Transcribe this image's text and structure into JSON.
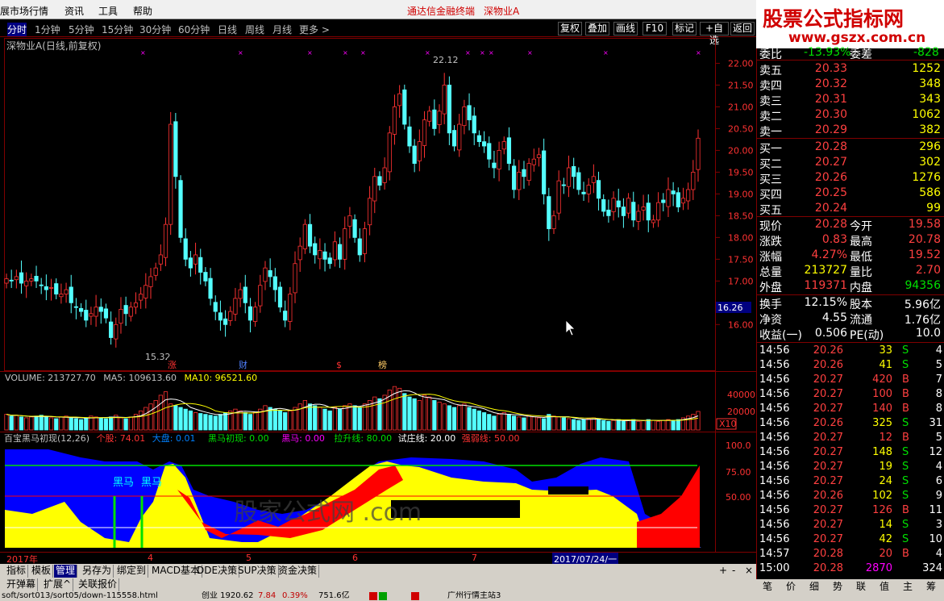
{
  "menu": {
    "items": [
      "展市场行情",
      "资讯",
      "工具",
      "帮助"
    ],
    "app_title": "通达信金融终端",
    "stock_title": "深物业A"
  },
  "logo": {
    "line1": "股票公式指标网",
    "line2": "www.gszx.com.cn"
  },
  "periods": {
    "items": [
      "分时",
      "1分钟",
      "5分钟",
      "15分钟",
      "30分钟",
      "60分钟",
      "日线",
      "周线",
      "月线",
      "更多 >"
    ],
    "active": "日线"
  },
  "toolbar_right": [
    "复权",
    "叠加",
    "画线",
    "F10",
    "标记",
    "+自选",
    "返回"
  ],
  "main_chart": {
    "caption": "深物业A(日线,前复权)",
    "high_label": "22.12",
    "low_label": "15.32",
    "current_price_tag": "16.26",
    "price_ticks": [
      "22.00",
      "21.50",
      "21.00",
      "20.50",
      "20.00",
      "19.50",
      "19.00",
      "18.50",
      "18.00",
      "17.50",
      "17.00",
      "16.00"
    ],
    "events": [
      "涨",
      "财",
      "$",
      "榜"
    ],
    "up_color": "#ff3232",
    "down_color": "#54ffff"
  },
  "chart_data": [
    {
      "type": "candlestick",
      "title": "深物业A(日线,前复权)",
      "ylim": [
        15.32,
        22.12
      ],
      "y_ticks": [
        16.0,
        17.0,
        17.5,
        18.0,
        18.5,
        19.0,
        19.5,
        20.0,
        20.5,
        21.0,
        21.5,
        22.0
      ],
      "close": [
        17.05,
        17.0,
        17.1,
        16.95,
        17.0,
        17.05,
        17.0,
        16.9,
        16.8,
        16.85,
        16.7,
        16.7,
        16.8,
        16.5,
        16.4,
        16.3,
        16.1,
        16.25,
        16.4,
        16.3,
        16.15,
        15.7,
        16.0,
        16.35,
        16.25,
        16.4,
        16.5,
        16.7,
        16.9,
        17.1,
        17.3,
        17.6,
        18.3,
        20.6,
        19.4,
        18.0,
        17.5,
        17.3,
        17.6,
        17.2,
        17.0,
        16.6,
        16.3,
        16.1,
        16.0,
        16.3,
        16.6,
        16.8,
        16.5,
        16.1,
        16.4,
        16.9,
        17.3,
        17.1,
        16.8,
        16.4,
        16.1,
        16.7,
        17.4,
        17.8,
        18.3,
        17.8,
        17.6,
        17.7,
        17.5,
        17.4,
        17.9,
        17.5,
        18.2,
        18.5,
        18.0,
        17.6,
        18.2,
        18.9,
        19.4,
        19.2,
        19.6,
        20.4,
        21.0,
        21.3,
        20.6,
        20.1,
        19.7,
        20.2,
        20.7,
        20.9,
        20.5,
        20.9,
        21.5,
        20.4,
        20.1,
        20.6,
        21.0,
        20.7,
        20.4,
        20.2,
        20.1,
        19.8,
        19.6,
        20.0,
        20.2,
        19.7,
        19.1,
        19.5,
        19.4,
        19.7,
        19.8,
        19.9,
        19.0,
        18.2,
        18.5,
        19.3,
        19.2,
        19.6,
        19.4,
        19.1,
        19.0,
        19.2,
        19.4,
        18.9,
        18.6,
        18.5,
        18.9,
        18.7,
        18.5,
        18.9,
        18.4,
        18.6,
        18.7,
        18.4,
        18.4,
        18.8,
        18.8,
        19.1,
        19.0,
        18.7,
        18.9,
        19.1,
        19.5,
        20.28
      ],
      "volume": [
        18000,
        16000,
        17000,
        15000,
        14000,
        15000,
        16000,
        17000,
        15000,
        14000,
        13000,
        15000,
        16000,
        14000,
        13000,
        12000,
        14000,
        16000,
        15000,
        14000,
        13000,
        15000,
        17000,
        14000,
        13000,
        15000,
        18000,
        22000,
        26000,
        30000,
        34000,
        40000,
        44000,
        30000,
        28000,
        26000,
        24000,
        22000,
        20000,
        19000,
        18000,
        17000,
        16000,
        18000,
        20000,
        22000,
        24000,
        22000,
        20000,
        18000,
        20000,
        24000,
        28000,
        26000,
        24000,
        22000,
        20000,
        22000,
        26000,
        30000,
        34000,
        30000,
        28000,
        26000,
        24000,
        22000,
        26000,
        24000,
        28000,
        30000,
        28000,
        26000,
        30000,
        34000,
        38000,
        36000,
        40000,
        46000,
        50000,
        48000,
        42000,
        38000,
        36000,
        34000,
        40000,
        38000,
        34000,
        32000,
        30000,
        28000,
        26000,
        28000,
        30000,
        26000,
        24000,
        22000,
        20000,
        18000,
        16000,
        18000,
        20000,
        18000,
        16000,
        15000,
        14000,
        16000,
        15000,
        14000,
        13000,
        18000,
        16000,
        15000,
        14000,
        13000,
        12000,
        11000,
        12000,
        13000,
        14000,
        12000,
        11000,
        10000,
        11000,
        12000,
        10000,
        11000,
        12000,
        10000,
        11000,
        12000,
        11000,
        10000,
        11000,
        12000,
        11000,
        12000,
        14000,
        16000,
        18000,
        21372
      ]
    }
  ],
  "volume_panel": {
    "caption": "VOLUME: 213727.70",
    "ma5": "MA5: 109613.60",
    "ma10": "MA10: 96521.60",
    "ticks": [
      "40000",
      "20000"
    ],
    "unit": "X10"
  },
  "indicator_panel": {
    "name": "百宝黑马初现(12,26)",
    "parts": [
      {
        "label": "个股: 74.01",
        "color": "#ff3232"
      },
      {
        "label": "大盘: 0.01",
        "color": "#0080ff"
      },
      {
        "label": "黑马初现: 0.00",
        "color": "#00e000"
      },
      {
        "label": "黑马: 0.00",
        "color": "#ff00ff"
      },
      {
        "label": "拉升线: 80.00",
        "color": "#00e000"
      },
      {
        "label": "试庄线: 20.00",
        "color": "#ffffff"
      },
      {
        "label": "强弱线: 50.00",
        "color": "#ff3232"
      }
    ],
    "ticks": [
      "100.0",
      "75.00",
      "50.00"
    ],
    "labels": [
      "黑马",
      "黑马"
    ],
    "watermark": "股家公式网 .com"
  },
  "time_axis": {
    "labels": [
      "2017年",
      "4",
      "5",
      "6",
      "7"
    ],
    "cursor_date": "2017/07/24/一"
  },
  "bottom_tabs": {
    "row1": [
      "指标",
      "模板",
      "管理",
      "另存为",
      "绑定到",
      "MACD基本",
      "DDE决策",
      "SUP决策",
      "资金决策"
    ],
    "row1_selected": "管理",
    "row2": [
      "开弹幕",
      "扩展^",
      "关联报价"
    ],
    "scroll": [
      "+",
      "-",
      "×"
    ]
  },
  "status": {
    "url": "soft/sort013/sort05/down-115558.html",
    "index": "创业 1920.62",
    "change": "7.84",
    "pct": "0.39%",
    "amount": "751.6亿",
    "note": "广州行情主站3"
  },
  "quote": {
    "ratio": {
      "label": "委比",
      "value": "-13.93%",
      "label2": "委差",
      "value2": "-828"
    },
    "asks": [
      {
        "label": "卖五",
        "price": "20.33",
        "vol": "1252"
      },
      {
        "label": "卖四",
        "price": "20.32",
        "vol": "348"
      },
      {
        "label": "卖三",
        "price": "20.31",
        "vol": "343"
      },
      {
        "label": "卖二",
        "price": "20.30",
        "vol": "1062"
      },
      {
        "label": "卖一",
        "price": "20.29",
        "vol": "382"
      }
    ],
    "bids": [
      {
        "label": "买一",
        "price": "20.28",
        "vol": "296"
      },
      {
        "label": "买二",
        "price": "20.27",
        "vol": "302"
      },
      {
        "label": "买三",
        "price": "20.26",
        "vol": "1276"
      },
      {
        "label": "买四",
        "price": "20.25",
        "vol": "586"
      },
      {
        "label": "买五",
        "price": "20.24",
        "vol": "99"
      }
    ],
    "stats": [
      {
        "l1": "现价",
        "v1": "20.28",
        "l2": "今开",
        "v2": "19.58"
      },
      {
        "l1": "涨跌",
        "v1": "0.83",
        "l2": "最高",
        "v2": "20.78"
      },
      {
        "l1": "涨幅",
        "v1": "4.27%",
        "l2": "最低",
        "v2": "19.52"
      },
      {
        "l1": "总量",
        "v1": "213727",
        "l2": "量比",
        "v2": "2.70"
      },
      {
        "l1": "外盘",
        "v1": "119371",
        "l2": "内盘",
        "v2": "94356"
      }
    ],
    "fundamentals": [
      {
        "l1": "换手",
        "v1": "12.15%",
        "l2": "股本",
        "v2": "5.96亿"
      },
      {
        "l1": "净资",
        "v1": "4.55",
        "l2": "流通",
        "v2": "1.76亿"
      },
      {
        "l1": "收益(一)",
        "v1": "0.506",
        "l2": "PE(动)",
        "v2": "10.0"
      }
    ],
    "ticks": [
      {
        "t": "14:56",
        "p": "20.26",
        "v": "33",
        "s": "S",
        "n": "4"
      },
      {
        "t": "14:56",
        "p": "20.26",
        "v": "41",
        "s": "S",
        "n": "5"
      },
      {
        "t": "14:56",
        "p": "20.27",
        "v": "420",
        "s": "B",
        "n": "7"
      },
      {
        "t": "14:56",
        "p": "20.27",
        "v": "100",
        "s": "B",
        "n": "8"
      },
      {
        "t": "14:56",
        "p": "20.27",
        "v": "140",
        "s": "B",
        "n": "8"
      },
      {
        "t": "14:56",
        "p": "20.26",
        "v": "325",
        "s": "S",
        "n": "31"
      },
      {
        "t": "14:56",
        "p": "20.27",
        "v": "12",
        "s": "B",
        "n": "5"
      },
      {
        "t": "14:56",
        "p": "20.27",
        "v": "148",
        "s": "S",
        "n": "12"
      },
      {
        "t": "14:56",
        "p": "20.27",
        "v": "19",
        "s": "S",
        "n": "4"
      },
      {
        "t": "14:56",
        "p": "20.27",
        "v": "24",
        "s": "S",
        "n": "6"
      },
      {
        "t": "14:56",
        "p": "20.26",
        "v": "102",
        "s": "S",
        "n": "9"
      },
      {
        "t": "14:56",
        "p": "20.27",
        "v": "126",
        "s": "B",
        "n": "11"
      },
      {
        "t": "14:56",
        "p": "20.27",
        "v": "14",
        "s": "S",
        "n": "3"
      },
      {
        "t": "14:56",
        "p": "20.27",
        "v": "42",
        "s": "S",
        "n": "10"
      },
      {
        "t": "14:57",
        "p": "20.28",
        "v": "20",
        "s": "B",
        "n": "4"
      },
      {
        "t": "15:00",
        "p": "20.28",
        "v": "2870",
        "s": "",
        "n": "324"
      }
    ]
  },
  "right_tabs": [
    "笔",
    "价",
    "细",
    "势",
    "联",
    "值",
    "主",
    "筹"
  ]
}
